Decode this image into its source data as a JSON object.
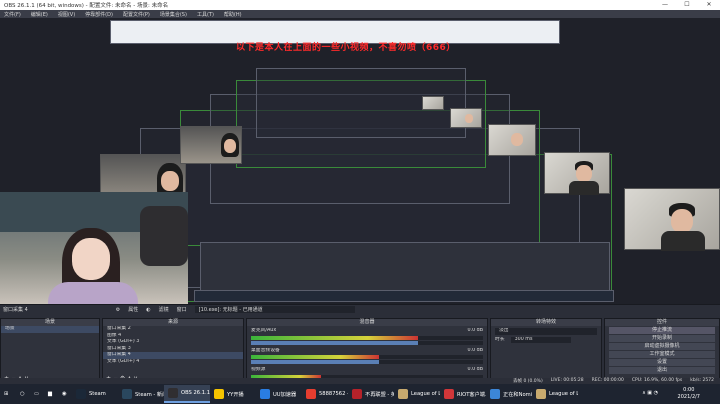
{
  "window": {
    "title": "OBS 26.1.1 (64 bit, windows) - 配置文件: 未命名 - 场景: 未命名",
    "minimize": "—",
    "maximize": "☐",
    "close": "✕"
  },
  "menu": [
    "文件(F)",
    "编辑(E)",
    "视图(V)",
    "停靠部件(D)",
    "配置文件(P)",
    "场景集合(S)",
    "工具(T)",
    "帮助(H)"
  ],
  "overlay_text": "以下是本人在上面的一些小视频，不喜勿喷（666）",
  "source_label": "窗口采集 4",
  "toolbar": {
    "properties": "属性",
    "filters": "滤镜",
    "window_label": "窗口",
    "window_value": "[10.exe]: 无标题 - 已用通道"
  },
  "docks": {
    "scenes": {
      "title": "场景",
      "items": [
        "场景"
      ]
    },
    "sources": {
      "title": "来源",
      "items": [
        "窗口采集 2",
        "图像 4",
        "文本 (GDI+) 3",
        "窗口采集 3",
        "窗口采集 4",
        "文本 (GDI+) 4"
      ]
    },
    "mixer": {
      "title": "混音器",
      "channels": [
        {
          "name": "麦克风/Aux",
          "db": "0.0 dB",
          "level": 0.72
        },
        {
          "name": "桌面音频设备",
          "db": "0.0 dB",
          "level": 0.55
        },
        {
          "name": "视频源",
          "db": "0.0 dB",
          "level": 0.3
        }
      ]
    },
    "transitions": {
      "title": "转场特效",
      "type": "淡出",
      "duration_label": "时长",
      "duration": "300 ms"
    },
    "controls": {
      "title": "控件",
      "buttons": [
        "停止推流",
        "开始录制",
        "启动虚拟摄像机",
        "工作室模式",
        "设置",
        "退出"
      ]
    }
  },
  "status": {
    "dropped": "丢帧 0 (0.0%)",
    "live": "LIVE: 00:05:28",
    "rec": "REC: 00:00:00",
    "cpu": "CPU: 16.9%, 60.00 fps",
    "kbps": "kb/s: 2572"
  },
  "taskbar": {
    "items": [
      {
        "label": "Steam",
        "color": "#1b2838"
      },
      {
        "label": "Steam - 新闻...",
        "color": "#2a475e"
      },
      {
        "label": "OBS 26.1.1 (...",
        "color": "#302e31",
        "active": true
      },
      {
        "label": "YY开播",
        "color": "#f5c400"
      },
      {
        "label": "UU加速器",
        "color": "#2a7de1"
      },
      {
        "label": "58887562 - [...",
        "color": "#e63d2f"
      },
      {
        "label": "不再联盟 - 英...",
        "color": "#b6222a"
      },
      {
        "label": "League of Le...",
        "color": "#c8aa6e"
      },
      {
        "label": "RIOT客户端...",
        "color": "#d13639"
      },
      {
        "label": "正在和Nomi...",
        "color": "#3c86d6"
      },
      {
        "label": "League of Le...",
        "color": "#c8aa6e"
      }
    ],
    "time": "0:00",
    "date": "2021/2/7"
  }
}
